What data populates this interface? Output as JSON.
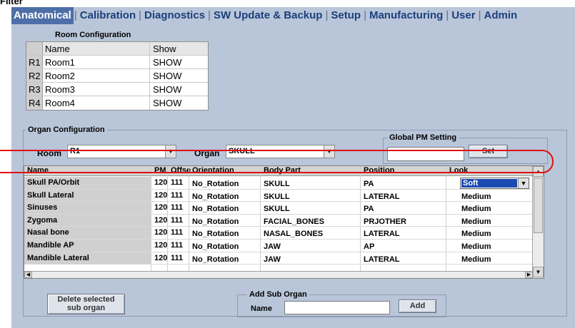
{
  "window": {
    "title": "Filter"
  },
  "tabs": [
    {
      "label": "Anatomical",
      "active": true
    },
    {
      "label": "Calibration"
    },
    {
      "label": "Diagnostics"
    },
    {
      "label": "SW Update & Backup"
    },
    {
      "label": "Setup"
    },
    {
      "label": "Manufacturing"
    },
    {
      "label": "User"
    },
    {
      "label": "Admin"
    }
  ],
  "room_config": {
    "title": "Room Configuration",
    "headers": {
      "name": "Name",
      "show": "Show"
    },
    "rows": [
      {
        "id": "R1",
        "name": "Room1",
        "show": "SHOW"
      },
      {
        "id": "R2",
        "name": "Room2",
        "show": "SHOW"
      },
      {
        "id": "R3",
        "name": "Room3",
        "show": "SHOW"
      },
      {
        "id": "R4",
        "name": "Room4",
        "show": "SHOW"
      }
    ]
  },
  "organ_config": {
    "title": "Organ Configuration",
    "room_label": "Room",
    "room_value": "R1",
    "organ_label": "Organ",
    "organ_value": "SKULL",
    "global_pm": {
      "title": "Global PM Setting",
      "value": "",
      "set_label": "Set"
    },
    "columns": [
      "Name",
      "PM",
      "Offse",
      "Orientation",
      "Body Part",
      "Position",
      "Look"
    ],
    "rows": [
      {
        "name": "Skull PA/Orbit",
        "pm": "120",
        "offset": "111",
        "orientation": "No_Rotation",
        "body_part": "SKULL",
        "position": "PA",
        "look": "Soft"
      },
      {
        "name": "Skull Lateral",
        "pm": "120",
        "offset": "111",
        "orientation": "No_Rotation",
        "body_part": "SKULL",
        "position": "LATERAL",
        "look": "Medium"
      },
      {
        "name": "Sinuses",
        "pm": "120",
        "offset": "111",
        "orientation": "No_Rotation",
        "body_part": "SKULL",
        "position": "PA",
        "look": "Medium"
      },
      {
        "name": "Zygoma",
        "pm": "120",
        "offset": "111",
        "orientation": "No_Rotation",
        "body_part": "FACIAL_BONES",
        "position": "PRJOTHER",
        "look": "Medium"
      },
      {
        "name": "Nasal bone",
        "pm": "120",
        "offset": "111",
        "orientation": "No_Rotation",
        "body_part": "NASAL_BONES",
        "position": "LATERAL",
        "look": "Medium"
      },
      {
        "name": "Mandible AP",
        "pm": "120",
        "offset": "111",
        "orientation": "No_Rotation",
        "body_part": "JAW",
        "position": "AP",
        "look": "Medium"
      },
      {
        "name": "Mandible Lateral",
        "pm": "120",
        "offset": "111",
        "orientation": "No_Rotation",
        "body_part": "JAW",
        "position": "LATERAL",
        "look": "Medium"
      }
    ],
    "delete_button": "Delete selected sub organ",
    "add_sub_organ": {
      "title": "Add Sub Organ",
      "name_label": "Name",
      "name_value": "",
      "add_label": "Add"
    }
  },
  "colors": {
    "tab_active_bg": "#4d6fa8",
    "panel_bg": "#b9c6d9",
    "highlight": "#e01010",
    "selection": "#1c4bb0"
  }
}
